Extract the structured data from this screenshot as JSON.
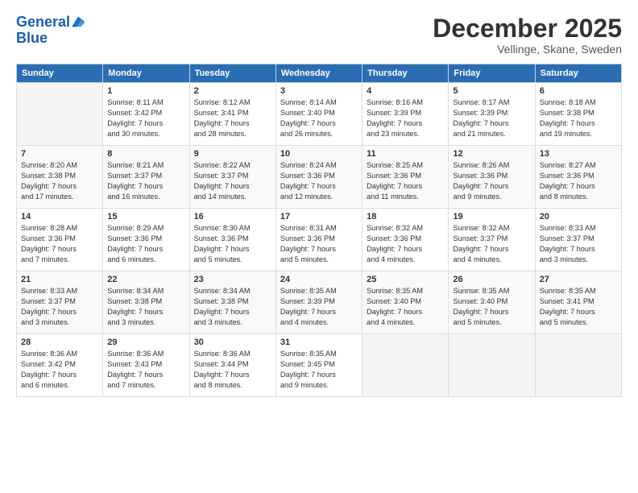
{
  "header": {
    "logo_line1": "General",
    "logo_line2": "Blue",
    "month": "December 2025",
    "location": "Vellinge, Skane, Sweden"
  },
  "days_of_week": [
    "Sunday",
    "Monday",
    "Tuesday",
    "Wednesday",
    "Thursday",
    "Friday",
    "Saturday"
  ],
  "weeks": [
    [
      {
        "day": "",
        "content": ""
      },
      {
        "day": "1",
        "content": "Sunrise: 8:11 AM\nSunset: 3:42 PM\nDaylight: 7 hours\nand 30 minutes."
      },
      {
        "day": "2",
        "content": "Sunrise: 8:12 AM\nSunset: 3:41 PM\nDaylight: 7 hours\nand 28 minutes."
      },
      {
        "day": "3",
        "content": "Sunrise: 8:14 AM\nSunset: 3:40 PM\nDaylight: 7 hours\nand 26 minutes."
      },
      {
        "day": "4",
        "content": "Sunrise: 8:16 AM\nSunset: 3:39 PM\nDaylight: 7 hours\nand 23 minutes."
      },
      {
        "day": "5",
        "content": "Sunrise: 8:17 AM\nSunset: 3:39 PM\nDaylight: 7 hours\nand 21 minutes."
      },
      {
        "day": "6",
        "content": "Sunrise: 8:18 AM\nSunset: 3:38 PM\nDaylight: 7 hours\nand 19 minutes."
      }
    ],
    [
      {
        "day": "7",
        "content": "Sunrise: 8:20 AM\nSunset: 3:38 PM\nDaylight: 7 hours\nand 17 minutes."
      },
      {
        "day": "8",
        "content": "Sunrise: 8:21 AM\nSunset: 3:37 PM\nDaylight: 7 hours\nand 16 minutes."
      },
      {
        "day": "9",
        "content": "Sunrise: 8:22 AM\nSunset: 3:37 PM\nDaylight: 7 hours\nand 14 minutes."
      },
      {
        "day": "10",
        "content": "Sunrise: 8:24 AM\nSunset: 3:36 PM\nDaylight: 7 hours\nand 12 minutes."
      },
      {
        "day": "11",
        "content": "Sunrise: 8:25 AM\nSunset: 3:36 PM\nDaylight: 7 hours\nand 11 minutes."
      },
      {
        "day": "12",
        "content": "Sunrise: 8:26 AM\nSunset: 3:36 PM\nDaylight: 7 hours\nand 9 minutes."
      },
      {
        "day": "13",
        "content": "Sunrise: 8:27 AM\nSunset: 3:36 PM\nDaylight: 7 hours\nand 8 minutes."
      }
    ],
    [
      {
        "day": "14",
        "content": "Sunrise: 8:28 AM\nSunset: 3:36 PM\nDaylight: 7 hours\nand 7 minutes."
      },
      {
        "day": "15",
        "content": "Sunrise: 8:29 AM\nSunset: 3:36 PM\nDaylight: 7 hours\nand 6 minutes."
      },
      {
        "day": "16",
        "content": "Sunrise: 8:30 AM\nSunset: 3:36 PM\nDaylight: 7 hours\nand 5 minutes."
      },
      {
        "day": "17",
        "content": "Sunrise: 8:31 AM\nSunset: 3:36 PM\nDaylight: 7 hours\nand 5 minutes."
      },
      {
        "day": "18",
        "content": "Sunrise: 8:32 AM\nSunset: 3:36 PM\nDaylight: 7 hours\nand 4 minutes."
      },
      {
        "day": "19",
        "content": "Sunrise: 8:32 AM\nSunset: 3:37 PM\nDaylight: 7 hours\nand 4 minutes."
      },
      {
        "day": "20",
        "content": "Sunrise: 8:33 AM\nSunset: 3:37 PM\nDaylight: 7 hours\nand 3 minutes."
      }
    ],
    [
      {
        "day": "21",
        "content": "Sunrise: 8:33 AM\nSunset: 3:37 PM\nDaylight: 7 hours\nand 3 minutes."
      },
      {
        "day": "22",
        "content": "Sunrise: 8:34 AM\nSunset: 3:38 PM\nDaylight: 7 hours\nand 3 minutes."
      },
      {
        "day": "23",
        "content": "Sunrise: 8:34 AM\nSunset: 3:38 PM\nDaylight: 7 hours\nand 3 minutes."
      },
      {
        "day": "24",
        "content": "Sunrise: 8:35 AM\nSunset: 3:39 PM\nDaylight: 7 hours\nand 4 minutes."
      },
      {
        "day": "25",
        "content": "Sunrise: 8:35 AM\nSunset: 3:40 PM\nDaylight: 7 hours\nand 4 minutes."
      },
      {
        "day": "26",
        "content": "Sunrise: 8:35 AM\nSunset: 3:40 PM\nDaylight: 7 hours\nand 5 minutes."
      },
      {
        "day": "27",
        "content": "Sunrise: 8:35 AM\nSunset: 3:41 PM\nDaylight: 7 hours\nand 5 minutes."
      }
    ],
    [
      {
        "day": "28",
        "content": "Sunrise: 8:36 AM\nSunset: 3:42 PM\nDaylight: 7 hours\nand 6 minutes."
      },
      {
        "day": "29",
        "content": "Sunrise: 8:36 AM\nSunset: 3:43 PM\nDaylight: 7 hours\nand 7 minutes."
      },
      {
        "day": "30",
        "content": "Sunrise: 8:36 AM\nSunset: 3:44 PM\nDaylight: 7 hours\nand 8 minutes."
      },
      {
        "day": "31",
        "content": "Sunrise: 8:35 AM\nSunset: 3:45 PM\nDaylight: 7 hours\nand 9 minutes."
      },
      {
        "day": "",
        "content": ""
      },
      {
        "day": "",
        "content": ""
      },
      {
        "day": "",
        "content": ""
      }
    ]
  ]
}
